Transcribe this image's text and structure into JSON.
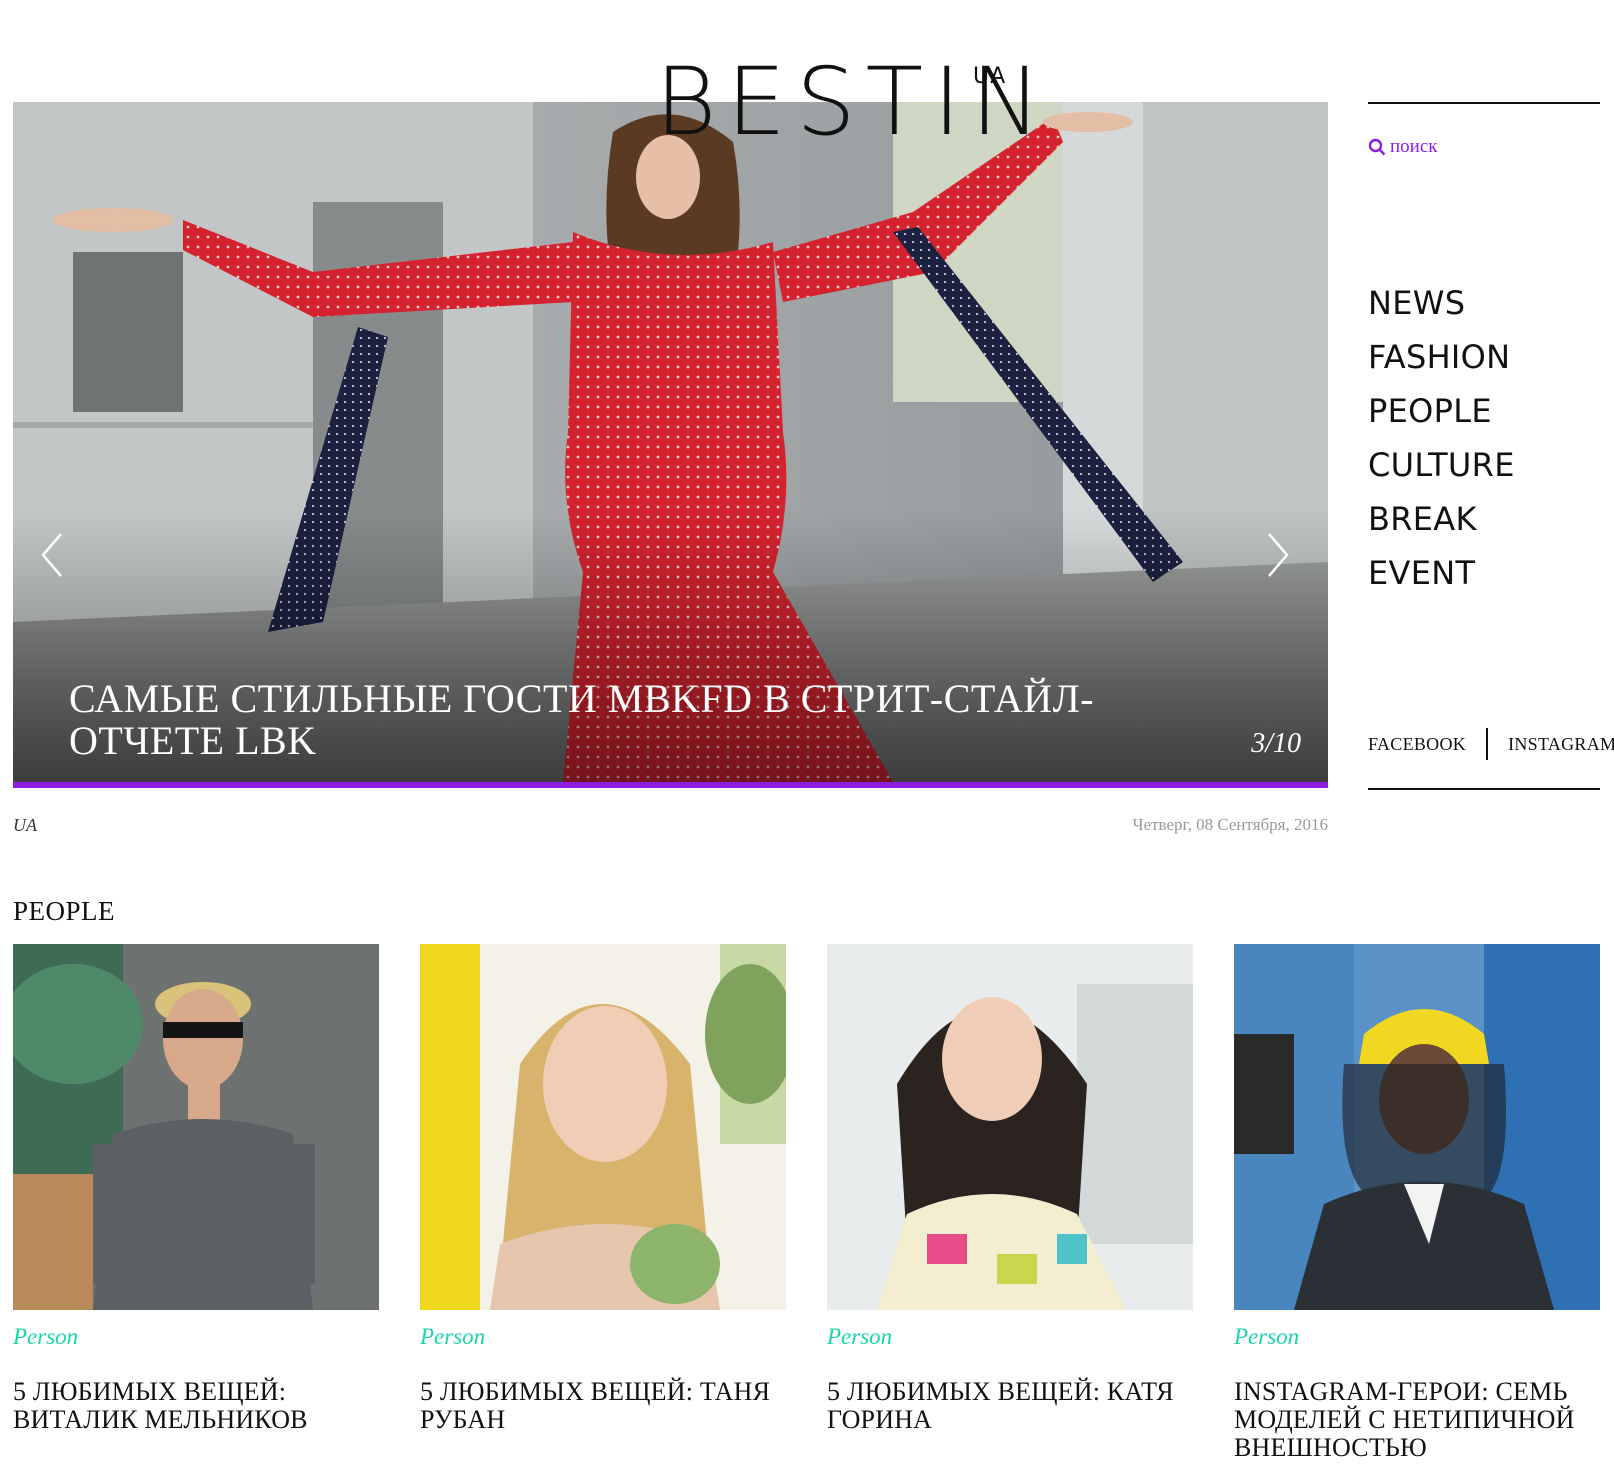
{
  "site": {
    "logo_text": "BESTIN",
    "logo_sup": "UA"
  },
  "colors": {
    "accent": "#8a1fe0",
    "category": "#19d6a8",
    "date": "#9a9a9a"
  },
  "hero": {
    "title": "САМЫЕ СТИЛЬНЫЕ ГОСТИ MBKFD В СТРИТ-СТАЙЛ-ОТЧЕТЕ LBK",
    "counter": "3/10",
    "prev_icon": "chevron-left-icon",
    "next_icon": "chevron-right-icon"
  },
  "meta": {
    "language": "UA",
    "date": "Четверг, 08 Сентября, 2016"
  },
  "sidebar": {
    "search_label": "поиск",
    "search_icon": "search-icon",
    "nav": [
      "NEWS",
      "FASHION",
      "PEOPLE",
      "CULTURE",
      "BREAK",
      "EVENT"
    ],
    "social": [
      "FACEBOOK",
      "INSTAGRAM"
    ]
  },
  "section": {
    "title": "PEOPLE",
    "cards": [
      {
        "category": "Person",
        "title": "5 ЛЮБИМЫХ ВЕЩЕЙ: ВИТАЛИК МЕЛЬНИКОВ"
      },
      {
        "category": "Person",
        "title": "5 ЛЮБИМЫХ ВЕЩЕЙ: ТАНЯ РУБАН"
      },
      {
        "category": "Person",
        "title": "5 ЛЮБИМЫХ ВЕЩЕЙ: КАТЯ ГОРИНА"
      },
      {
        "category": "Person",
        "title": "INSTAGRAM-ГЕРОИ: СЕМЬ МОДЕЛЕЙ С НЕТИПИЧНОЙ ВНЕШНОСТЬЮ"
      }
    ]
  }
}
